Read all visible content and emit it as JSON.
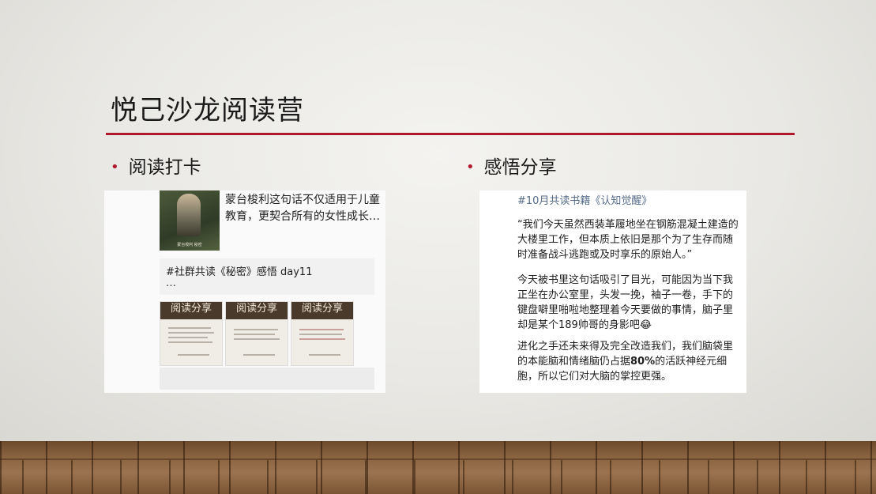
{
  "title": "悦己沙龙阅读营",
  "bullets": {
    "left": "阅读打卡",
    "right": "感悟分享"
  },
  "left_screenshot": {
    "cover_caption": "蒙台梭利 秘密",
    "post_text": "蒙台梭利这句话不仅适用于儿童教育，更契合所有的女性成长…",
    "card_heading": "#社群共读《秘密》感悟 day11",
    "card_ellipsis": "…",
    "thumb_title": "阅读分享"
  },
  "right_screenshot": {
    "heading": "#10月共读书籍《认知觉醒》",
    "paragraph1": "“我们今天虽然西装革履地坐在钢筋混凝土建造的大楼里工作，但本质上依旧是那个为了生存而随时准备战斗逃跑或及时享乐的原始人。”",
    "paragraph2": "今天被书里这句话吸引了目光，可能因为当下我正坐在办公室里，头发一挽，袖子一卷，手下的键盘噼里啪啦地整理着今天要做的事情，脑子里却是某个189帅哥的身影吧😂",
    "paragraph3_pre": "进化之手还未来得及完全改造我们，我们脑袋里的本能脑和情绪脑仍占据",
    "paragraph3_bold": "80%",
    "paragraph3_post": "的活跃神经元细胞，所以它们对大脑的掌控更强。"
  },
  "colors": {
    "accent_rule": "#b0192c",
    "bullet_dot": "#b0192c",
    "link_blue": "#556b8a"
  }
}
